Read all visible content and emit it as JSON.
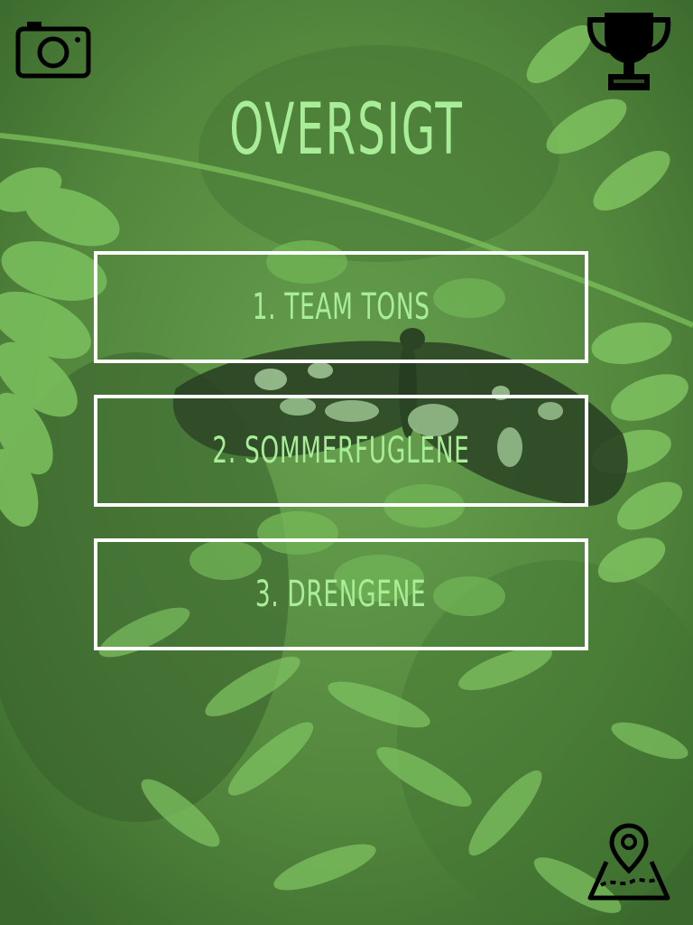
{
  "header": {
    "title": "OVERSIGT",
    "left_icon": "camera-icon",
    "right_icon": "trophy-icon"
  },
  "teams": [
    {
      "label": "1. TEAM TONS"
    },
    {
      "label": "2. SOMMERFUGLENE"
    },
    {
      "label": "3. DRENGENE"
    }
  ],
  "footer": {
    "map_icon": "map-pin-icon"
  },
  "colors": {
    "accent_text": "#a8ee98",
    "border": "#ffffff",
    "icon": "#000000"
  }
}
